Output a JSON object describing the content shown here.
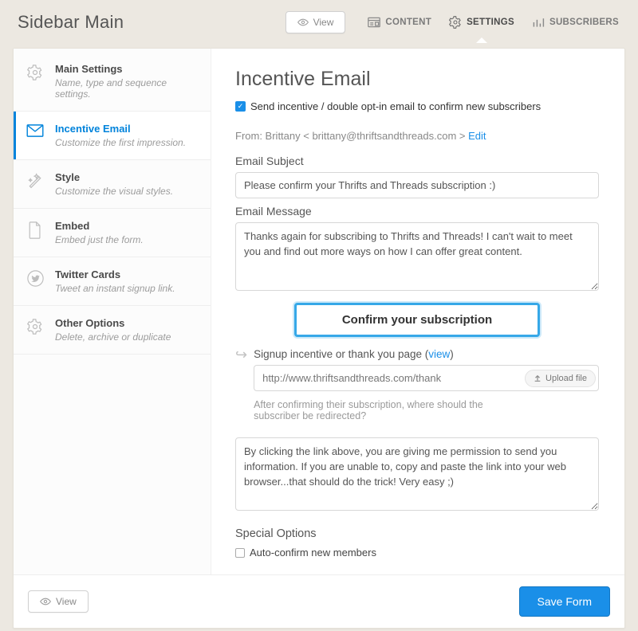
{
  "header": {
    "title": "Sidebar Main",
    "view_label": "View",
    "nav": {
      "content": "CONTENT",
      "settings": "SETTINGS",
      "subscribers": "SUBSCRIBERS"
    }
  },
  "sidebar": {
    "items": [
      {
        "title": "Main Settings",
        "desc": "Name, type and sequence settings."
      },
      {
        "title": "Incentive Email",
        "desc": "Customize the first impression."
      },
      {
        "title": "Style",
        "desc": "Customize the visual styles."
      },
      {
        "title": "Embed",
        "desc": "Embed just the form."
      },
      {
        "title": "Twitter Cards",
        "desc": "Tweet an instant signup link."
      },
      {
        "title": "Other Options",
        "desc": "Delete, archive or duplicate"
      }
    ]
  },
  "page": {
    "title": "Incentive Email",
    "send_checkbox_label": "Send incentive / double opt-in email to confirm new subscribers",
    "from_text": "From: Brittany < brittany@thriftsandthreads.com > ",
    "from_edit": "Edit",
    "subject_label": "Email Subject",
    "subject_value": "Please confirm your Thrifts and Threads subscription :)",
    "message_label": "Email Message",
    "message_value": "Thanks again for subscribing to Thrifts and Threads! I can't wait to meet you and find out more ways on how I can offer great content.",
    "confirm_button": "Confirm your subscription",
    "incentive_label_prefix": "Signup incentive or thank you page (",
    "incentive_view": "view",
    "incentive_label_suffix": ")",
    "incentive_url": "http://www.thriftsandthreads.com/thank",
    "upload_label": "Upload file",
    "redirect_hint": "After confirming their subscription, where should the subscriber be redirected?",
    "footer_text": "By clicking the link above, you are giving me permission to send you information. If you are unable to, copy and paste the link into your web browser...that should do the trick! Very easy ;)",
    "special_heading": "Special Options",
    "auto_confirm_label": "Auto-confirm new members"
  },
  "footer": {
    "view_label": "View",
    "save_label": "Save Form"
  }
}
